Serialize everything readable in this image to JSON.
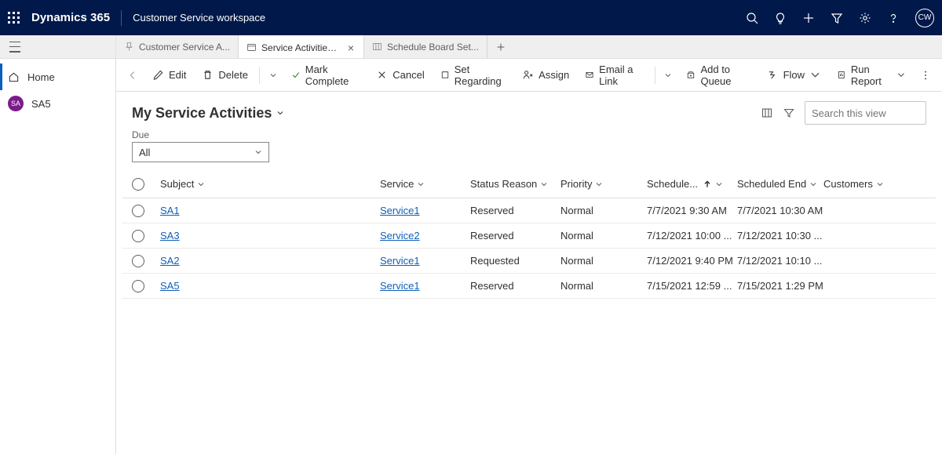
{
  "header": {
    "brand": "Dynamics 365",
    "workspace": "Customer Service workspace",
    "avatar": "CW"
  },
  "tabs": [
    {
      "label": "Customer Service A...",
      "active": false,
      "closable": false
    },
    {
      "label": "Service Activities My Ser...",
      "active": true,
      "closable": true
    },
    {
      "label": "Schedule Board Set...",
      "active": false,
      "closable": false
    }
  ],
  "nav": {
    "home": "Home",
    "sa": "SA5",
    "sa_badge": "SA"
  },
  "commands": {
    "edit": "Edit",
    "delete": "Delete",
    "mark_complete": "Mark Complete",
    "cancel": "Cancel",
    "set_regarding": "Set Regarding",
    "assign": "Assign",
    "email_link": "Email a Link",
    "add_queue": "Add to Queue",
    "flow": "Flow",
    "run_report": "Run Report"
  },
  "view": {
    "title": "My Service Activities",
    "search_placeholder": "Search this view",
    "filter_label": "Due",
    "filter_value": "All"
  },
  "columns": {
    "subject": "Subject",
    "service": "Service",
    "status": "Status Reason",
    "priority": "Priority",
    "start": "Schedule...",
    "end": "Scheduled End",
    "customers": "Customers"
  },
  "rows": [
    {
      "subject": "SA1",
      "service": "Service1",
      "status": "Reserved",
      "priority": "Normal",
      "start": "7/7/2021 9:30 AM",
      "end": "7/7/2021 10:30 AM",
      "cust": ""
    },
    {
      "subject": "SA3",
      "service": "Service2",
      "status": "Reserved",
      "priority": "Normal",
      "start": "7/12/2021 10:00 ...",
      "end": "7/12/2021 10:30 ...",
      "cust": ""
    },
    {
      "subject": "SA2",
      "service": "Service1",
      "status": "Requested",
      "priority": "Normal",
      "start": "7/12/2021 9:40 PM",
      "end": "7/12/2021 10:10 ...",
      "cust": ""
    },
    {
      "subject": "SA5",
      "service": "Service1",
      "status": "Reserved",
      "priority": "Normal",
      "start": "7/15/2021 12:59 ...",
      "end": "7/15/2021 1:29 PM",
      "cust": ""
    }
  ]
}
